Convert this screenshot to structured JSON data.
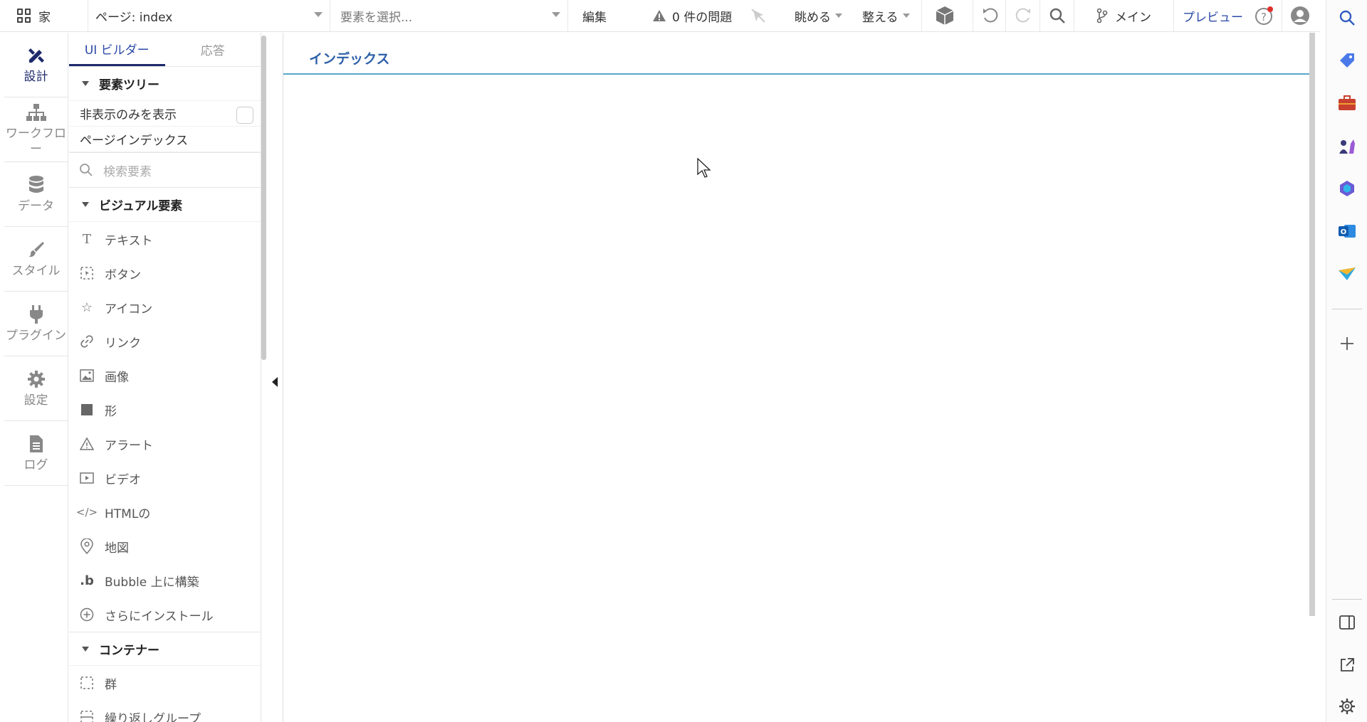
{
  "topbar": {
    "home_label": "家",
    "page_selector": "ページ: index",
    "element_selector_placeholder": "要素を選択...",
    "edit_label": "編集",
    "issues_label": "0 件の問題",
    "view_label": "眺める",
    "arrange_label": "整える",
    "branch_label": "メイン",
    "preview_label": "プレビュー"
  },
  "rail": {
    "items": [
      {
        "label": "設計",
        "icon": "design-icon"
      },
      {
        "label": "ワークフロー",
        "icon": "workflow-icon"
      },
      {
        "label": "データ",
        "icon": "database-icon"
      },
      {
        "label": "スタイル",
        "icon": "brush-icon"
      },
      {
        "label": "プラグイン",
        "icon": "plug-icon"
      },
      {
        "label": "設定",
        "icon": "gear-icon"
      },
      {
        "label": "ログ",
        "icon": "log-icon"
      }
    ]
  },
  "panel": {
    "tab_builder": "UI ビルダー",
    "tab_responsive": "応答",
    "element_tree_title": "要素ツリー",
    "show_hidden_only": "非表示のみを表示",
    "page_index": "ページインデックス",
    "search_placeholder": "検索要素",
    "visual_section_title": "ビジュアル要素",
    "visual_elements": [
      {
        "label": "テキスト",
        "icon": "text-icon"
      },
      {
        "label": "ボタン",
        "icon": "button-icon"
      },
      {
        "label": "アイコン",
        "icon": "star-icon"
      },
      {
        "label": "リンク",
        "icon": "link-icon"
      },
      {
        "label": "画像",
        "icon": "image-icon"
      },
      {
        "label": "形",
        "icon": "shape-icon"
      },
      {
        "label": "アラート",
        "icon": "alert-icon"
      },
      {
        "label": "ビデオ",
        "icon": "video-icon"
      },
      {
        "label": "HTMLの",
        "icon": "code-icon"
      },
      {
        "label": "地図",
        "icon": "map-pin-icon"
      },
      {
        "label": "Bubble 上に構築",
        "icon": "bubble-icon"
      },
      {
        "label": "さらにインストール",
        "icon": "plus-circle-icon"
      }
    ],
    "containers_section_title": "コンテナー",
    "containers": [
      {
        "label": "群",
        "icon": "group-icon"
      },
      {
        "label": "繰り返しグループ",
        "icon": "repeating-group-icon"
      }
    ]
  },
  "canvas": {
    "page_tab_label": "インデックス"
  },
  "colors": {
    "accent": "#1d2a6b",
    "link_blue": "#2c5fa8",
    "page_tab_underline": "#5aa7c9"
  }
}
